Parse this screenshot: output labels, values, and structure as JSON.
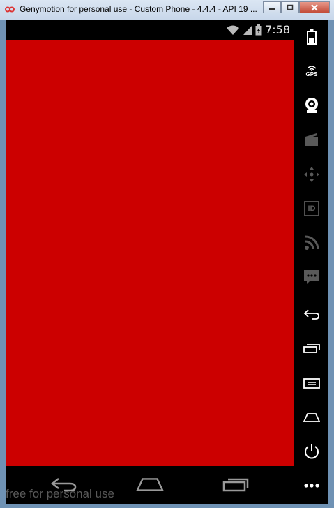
{
  "window": {
    "title": "Genymotion for personal use - Custom Phone - 4.4.4 - API 19 ...",
    "controls": [
      "minimize",
      "maximize",
      "close"
    ]
  },
  "statusbar": {
    "time": "7:58",
    "icons": [
      "wifi-icon",
      "signal-icon",
      "battery-icon"
    ]
  },
  "screen": {
    "background": "#cc0000"
  },
  "navbar": {
    "buttons": [
      "back",
      "home",
      "recent-apps"
    ]
  },
  "watermark": {
    "text": "free for personal use"
  },
  "sidebar": {
    "buttons": [
      {
        "name": "battery",
        "label": ""
      },
      {
        "name": "gps",
        "label": "GPS"
      },
      {
        "name": "webcam",
        "label": ""
      },
      {
        "name": "screencast",
        "label": ""
      },
      {
        "name": "pad",
        "label": ""
      },
      {
        "name": "identifiers",
        "label": "ID"
      },
      {
        "name": "network",
        "label": ""
      },
      {
        "name": "sms",
        "label": ""
      },
      {
        "name": "back",
        "label": ""
      },
      {
        "name": "recent-apps",
        "label": ""
      },
      {
        "name": "menu",
        "label": ""
      },
      {
        "name": "home",
        "label": ""
      },
      {
        "name": "power",
        "label": ""
      },
      {
        "name": "more",
        "label": ""
      }
    ]
  }
}
